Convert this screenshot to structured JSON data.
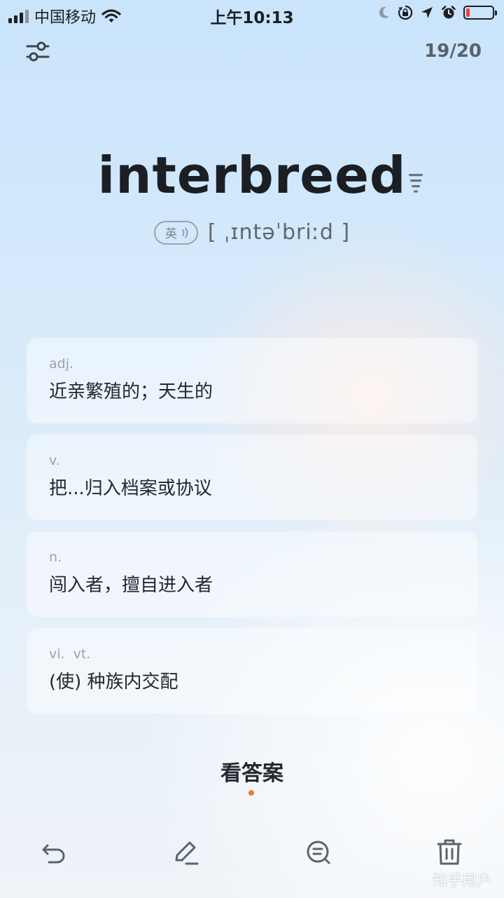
{
  "status_bar": {
    "carrier": "中国移动",
    "time": "上午10:13",
    "battery_level": 0.15,
    "icons": [
      "signal-icon",
      "wifi-icon",
      "moon-icon",
      "rotation-lock-icon",
      "location-icon",
      "alarm-icon",
      "battery-icon"
    ]
  },
  "header": {
    "counter": "19/20",
    "settings_icon": "sliders-icon"
  },
  "word": {
    "text": "interbreed",
    "accent_label": "英",
    "phonetic": "[ ˌɪntəˈbriːd ]"
  },
  "definitions": [
    {
      "pos": "adj.",
      "meaning": "近亲繁殖的；天生的"
    },
    {
      "pos": "v.",
      "meaning": "把...归入档案或协议"
    },
    {
      "pos": "n.",
      "meaning": "闯入者，擅自进入者"
    },
    {
      "pos": "vi.  vt.",
      "meaning": "(使) 种族内交配"
    }
  ],
  "answer_button": {
    "label": "看答案"
  },
  "toolbar": {
    "icons": [
      "undo-icon",
      "edit-icon",
      "search-note-icon",
      "trash-icon"
    ]
  },
  "watermark": "知乎用户",
  "colors": {
    "accent_dot": "#f07a2c",
    "battery_low": "#f04141"
  }
}
